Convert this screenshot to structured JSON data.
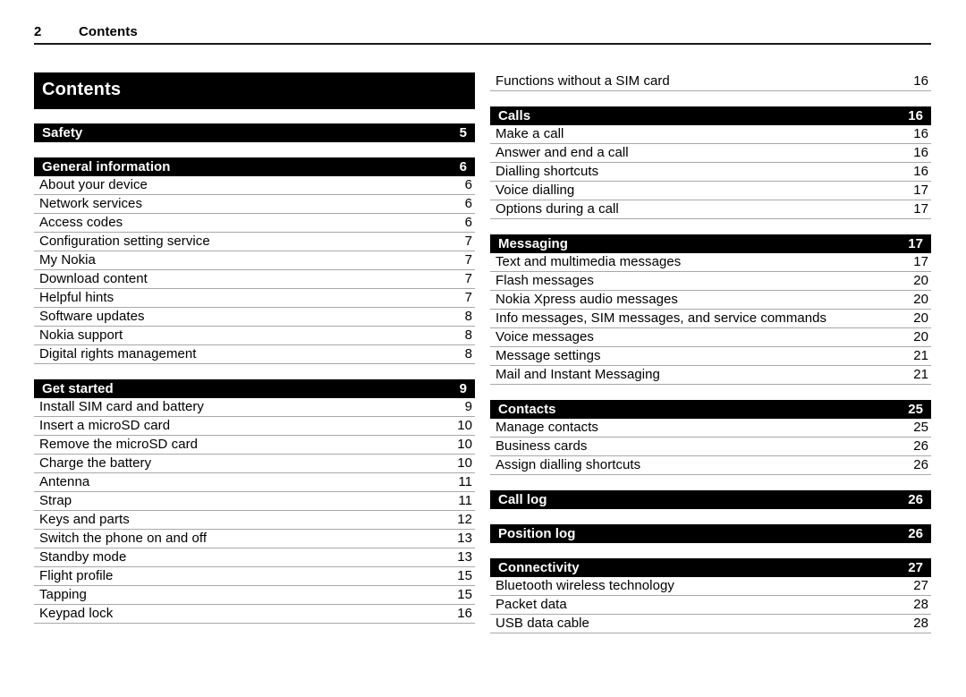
{
  "header": {
    "folio": "2",
    "running_title": "Contents"
  },
  "toc_title": "Contents",
  "columns": [
    {
      "name": "left-column",
      "sections": [
        {
          "type": "heading",
          "label": "Safety",
          "page": "5",
          "entries": []
        },
        {
          "type": "heading",
          "label": "General information",
          "page": "6",
          "entries": [
            {
              "label": "About your device",
              "page": "6"
            },
            {
              "label": "Network services",
              "page": "6"
            },
            {
              "label": "Access codes",
              "page": "6"
            },
            {
              "label": "Configuration setting service",
              "page": "7"
            },
            {
              "label": "My Nokia",
              "page": "7"
            },
            {
              "label": "Download content",
              "page": "7"
            },
            {
              "label": "Helpful hints",
              "page": "7"
            },
            {
              "label": "Software updates",
              "page": "8"
            },
            {
              "label": "Nokia support",
              "page": "8"
            },
            {
              "label": "Digital rights management",
              "page": "8"
            }
          ]
        },
        {
          "type": "heading",
          "label": "Get started",
          "page": "9",
          "entries": [
            {
              "label": "Install SIM card and battery",
              "page": "9"
            },
            {
              "label": "Insert a microSD card",
              "page": "10"
            },
            {
              "label": "Remove the microSD card",
              "page": "10"
            },
            {
              "label": "Charge the battery",
              "page": "10"
            },
            {
              "label": "Antenna",
              "page": "11"
            },
            {
              "label": "Strap",
              "page": "11"
            },
            {
              "label": "Keys and parts",
              "page": "12"
            },
            {
              "label": "Switch the phone on and off",
              "page": "13"
            },
            {
              "label": "Standby mode",
              "page": "13"
            },
            {
              "label": "Flight profile",
              "page": "15"
            },
            {
              "label": "Tapping",
              "page": "15"
            },
            {
              "label": "Keypad lock",
              "page": "16"
            }
          ]
        }
      ]
    },
    {
      "name": "right-column",
      "sections": [
        {
          "type": "continuation",
          "label": "",
          "page": "",
          "entries": [
            {
              "label": "Functions without a SIM card",
              "page": "16"
            }
          ]
        },
        {
          "type": "heading",
          "label": "Calls",
          "page": "16",
          "entries": [
            {
              "label": "Make a call",
              "page": "16"
            },
            {
              "label": "Answer and end a call",
              "page": "16"
            },
            {
              "label": "Dialling shortcuts",
              "page": "16"
            },
            {
              "label": "Voice dialling",
              "page": "17"
            },
            {
              "label": "Options during a call",
              "page": "17"
            }
          ]
        },
        {
          "type": "heading",
          "label": "Messaging",
          "page": "17",
          "entries": [
            {
              "label": "Text and multimedia messages",
              "page": "17"
            },
            {
              "label": "Flash messages",
              "page": "20"
            },
            {
              "label": "Nokia Xpress audio messages",
              "page": "20"
            },
            {
              "label": "Info messages, SIM messages, and service commands",
              "page": "20"
            },
            {
              "label": "Voice messages",
              "page": "20"
            },
            {
              "label": "Message settings",
              "page": "21"
            },
            {
              "label": "Mail and Instant Messaging",
              "page": "21"
            }
          ]
        },
        {
          "type": "heading",
          "label": "Contacts",
          "page": "25",
          "entries": [
            {
              "label": "Manage contacts",
              "page": "25"
            },
            {
              "label": "Business cards",
              "page": "26"
            },
            {
              "label": "Assign dialling shortcuts",
              "page": "26"
            }
          ]
        },
        {
          "type": "heading",
          "label": "Call log",
          "page": "26",
          "entries": []
        },
        {
          "type": "heading",
          "label": "Position log",
          "page": "26",
          "entries": []
        },
        {
          "type": "heading",
          "label": "Connectivity",
          "page": "27",
          "entries": [
            {
              "label": "Bluetooth wireless technology",
              "page": "27"
            },
            {
              "label": "Packet data",
              "page": "28"
            },
            {
              "label": "USB data cable",
              "page": "28"
            }
          ]
        }
      ]
    }
  ]
}
